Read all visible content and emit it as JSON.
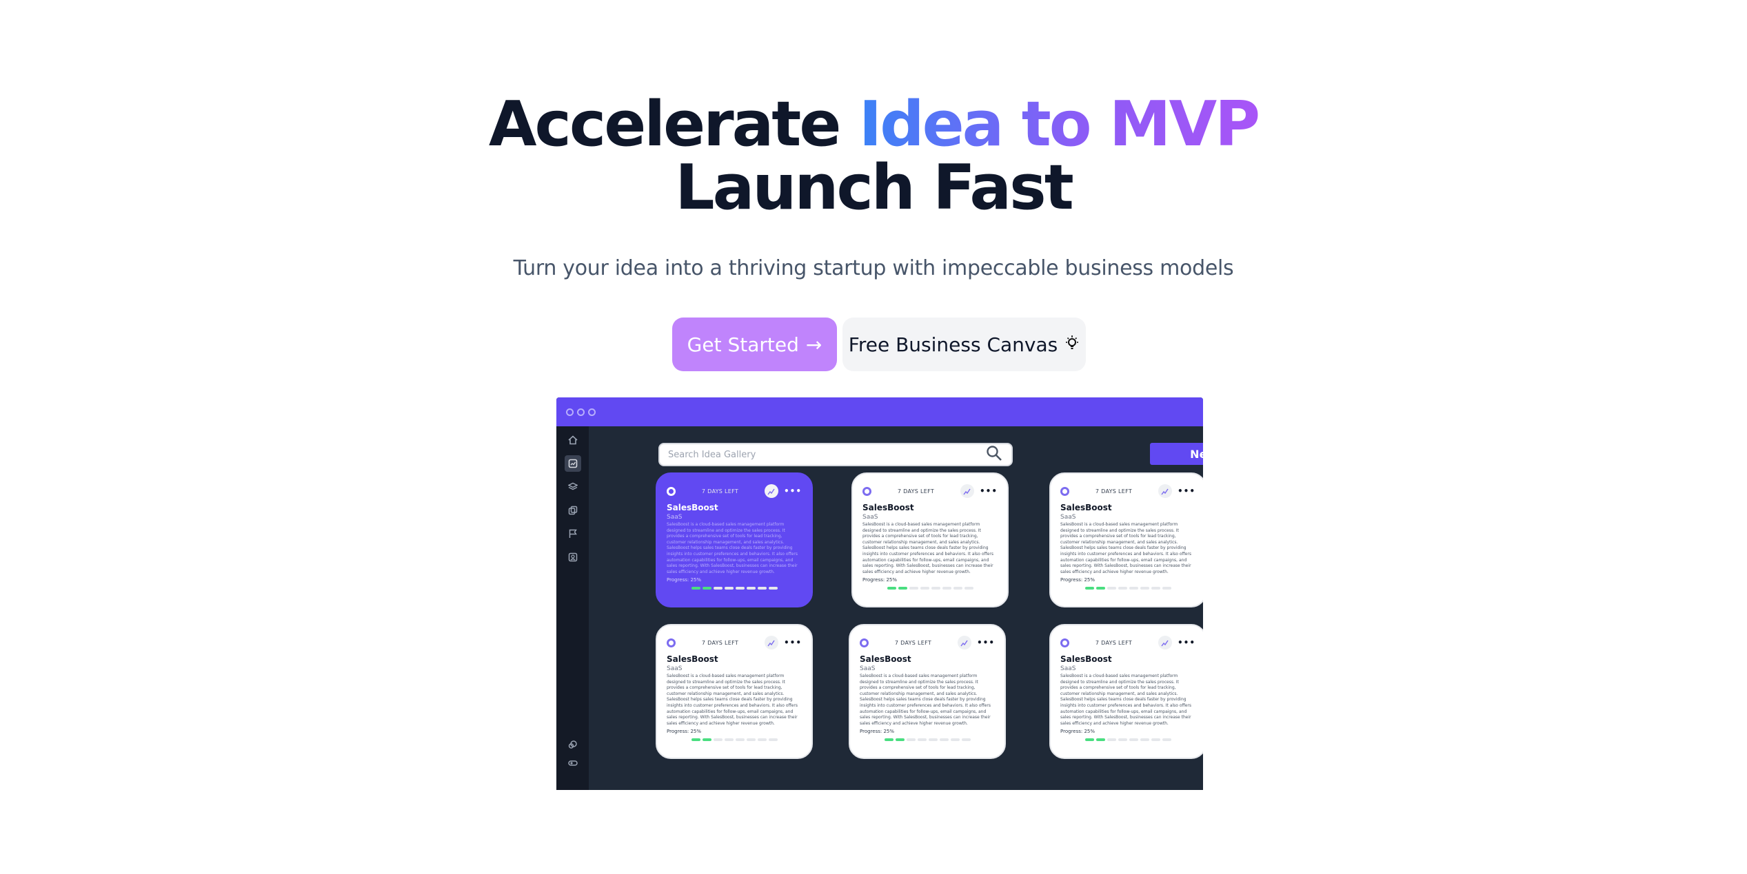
{
  "hero": {
    "headline_start": "Accelerate ",
    "headline_highlight": "Idea to MVP",
    "headline_line2": "Launch Fast",
    "subtitle": "Turn your idea into a thriving startup with impeccable business models",
    "primary_button": "Get Started",
    "primary_button_icon": "→",
    "secondary_button": "Free Business Canvas",
    "secondary_button_icon": "💡"
  },
  "colors": {
    "brand_purple": "#6149f2",
    "button_purple": "#c084fc",
    "gradient_start": "#3b82f6",
    "gradient_end": "#a855f7",
    "progress_green": "#4ade80"
  },
  "mockup": {
    "search_placeholder": "Search Idea Gallery",
    "new_idea_label": "New Idea",
    "sidebar_icons": [
      "home-icon",
      "dashboard-icon",
      "layers-icon",
      "copy-icon",
      "flag-icon",
      "profile-icon",
      "cloud-icon",
      "toggle-icon"
    ],
    "cards": [
      {
        "days_left": "7 DAYS LEFT",
        "title": "SalesBoost",
        "tag": "SaaS",
        "description": "SalesBoost is a cloud-based sales management platform designed to streamline and optimize the sales process. It provides a comprehensive set of tools for lead tracking, customer relationship management, and sales analytics. SalesBoost helps sales teams close deals faster by providing insights into customer preferences and behaviors. It also offers automation capabilities for follow-ups, email campaigns, and sales reporting. With SalesBoost, businesses can increase their sales efficiency and achieve higher revenue growth.",
        "progress": "Progress: 25%",
        "progress_value": 0.25,
        "highlighted": true
      },
      {
        "days_left": "7 DAYS LEFT",
        "title": "SalesBoost",
        "tag": "SaaS",
        "description": "SalesBoost is a cloud-based sales management platform designed to streamline and optimize the sales process. It provides a comprehensive set of tools for lead tracking, customer relationship management, and sales analytics. SalesBoost helps sales teams close deals faster by providing insights into customer preferences and behaviors. It also offers automation capabilities for follow-ups, email campaigns, and sales reporting. With SalesBoost, businesses can increase their sales efficiency and achieve higher revenue growth.",
        "progress": "Progress: 25%",
        "progress_value": 0.25,
        "highlighted": false
      },
      {
        "days_left": "7 DAYS LEFT",
        "title": "SalesBoost",
        "tag": "SaaS",
        "description": "SalesBoost is a cloud-based sales management platform designed to streamline and optimize the sales process. It provides a comprehensive set of tools for lead tracking, customer relationship management, and sales analytics. SalesBoost helps sales teams close deals faster by providing insights into customer preferences and behaviors. It also offers automation capabilities for follow-ups, email campaigns, and sales reporting. With SalesBoost, businesses can increase their sales efficiency and achieve higher revenue growth.",
        "progress": "Progress: 25%",
        "progress_value": 0.25,
        "highlighted": false
      },
      {
        "days_left": "7 DAYS LEFT",
        "title": "SalesBoost",
        "tag": "SaaS",
        "description": "SalesBoost is a cloud-based sales management platform designed to streamline and optimize the sales process. It provides a comprehensive set of tools for lead tracking, customer relationship management, and sales analytics. SalesBoost helps sales teams close deals faster by providing insights into customer preferences and behaviors. It also offers automation capabilities for follow-ups, email campaigns, and sales reporting. With SalesBoost, businesses can increase their sales efficiency and achieve higher revenue growth.",
        "progress": "Progress: 25%",
        "progress_value": 0.25,
        "highlighted": false
      },
      {
        "days_left": "7 DAYS LEFT",
        "title": "SalesBoost",
        "tag": "SaaS",
        "description": "SalesBoost is a cloud-based sales management platform designed to streamline and optimize the sales process. It provides a comprehensive set of tools for lead tracking, customer relationship management, and sales analytics. SalesBoost helps sales teams close deals faster by providing insights into customer preferences and behaviors. It also offers automation capabilities for follow-ups, email campaigns, and sales reporting. With SalesBoost, businesses can increase their sales efficiency and achieve higher revenue growth.",
        "progress": "Progress: 25%",
        "progress_value": 0.25,
        "highlighted": false
      },
      {
        "days_left": "7 DAYS LEFT",
        "title": "SalesBoost",
        "tag": "SaaS",
        "description": "SalesBoost is a cloud-based sales management platform designed to streamline and optimize the sales process. It provides a comprehensive set of tools for lead tracking, customer relationship management, and sales analytics. SalesBoost helps sales teams close deals faster by providing insights into customer preferences and behaviors. It also offers automation capabilities for follow-ups, email campaigns, and sales reporting. With SalesBoost, businesses can increase their sales efficiency and achieve higher revenue growth.",
        "progress": "Progress: 25%",
        "progress_value": 0.25,
        "highlighted": false
      }
    ]
  }
}
